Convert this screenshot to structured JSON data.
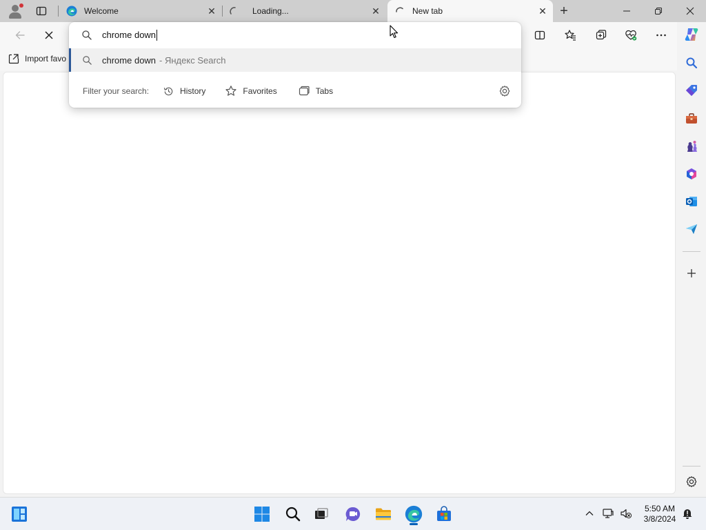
{
  "tabs": [
    {
      "title": "Welcome",
      "close": "✕"
    },
    {
      "title": "Loading...",
      "close": "✕"
    },
    {
      "title": "New tab",
      "close": "✕"
    }
  ],
  "newtab_label": "+",
  "favorites_bar": {
    "import_label": "Import favo"
  },
  "omnibox": {
    "query": "chrome down",
    "suggestion": {
      "text": "chrome down",
      "engine": "- Яндекс Search"
    },
    "filter_label": "Filter your search:",
    "filters": [
      {
        "label": "History",
        "icon": "history-icon"
      },
      {
        "label": "Favorites",
        "icon": "star-icon"
      },
      {
        "label": "Tabs",
        "icon": "tabs-icon"
      }
    ]
  },
  "taskbar": {
    "time": "5:50 AM",
    "date": "3/8/2024"
  },
  "colors": {
    "accent": "#2b5797",
    "tabstrip": "#cfcfcf",
    "content_bg": "#ffffff"
  }
}
